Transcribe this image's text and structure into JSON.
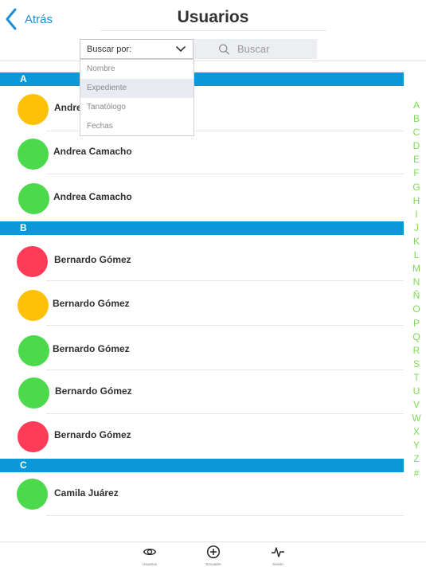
{
  "header": {
    "back_label": "Atrás",
    "title": "Usuarios"
  },
  "search": {
    "select_label": "Buscar por:",
    "placeholder": "Buscar"
  },
  "dropdown": {
    "options": [
      "Nombre",
      "Expediente",
      "Tanatólogo",
      "Fechas"
    ],
    "highlighted": "Expediente"
  },
  "sections": [
    {
      "letter": "A",
      "contacts": [
        {
          "name": "Andrea Camacho",
          "status_color": "#ffc107"
        },
        {
          "name": "Andrea Camacho",
          "status_color": "#4cd94c"
        },
        {
          "name": "Andrea Camacho",
          "status_color": "#4cd94c"
        }
      ]
    },
    {
      "letter": "B",
      "contacts": [
        {
          "name": "Bernardo Gómez",
          "status_color": "#ff3b57"
        },
        {
          "name": "Bernardo Gómez",
          "status_color": "#ffc107"
        },
        {
          "name": "Bernardo Gómez",
          "status_color": "#4cd94c"
        },
        {
          "name": "Bernardo Gómez",
          "status_color": "#4cd94c"
        },
        {
          "name": "Bernardo Gómez",
          "status_color": "#ff3b57"
        }
      ]
    },
    {
      "letter": "C",
      "contacts": [
        {
          "name": "Camila Juárez",
          "status_color": "#4cd94c"
        }
      ]
    }
  ],
  "alpha_index": [
    "A",
    "B",
    "C",
    "D",
    "E",
    "F",
    "G",
    "H",
    "I",
    "J",
    "K",
    "L",
    "M",
    "N",
    "Ñ",
    "O",
    "P",
    "Q",
    "R",
    "S",
    "T",
    "U",
    "V",
    "W",
    "X",
    "Y",
    "Z",
    "#"
  ],
  "tabbar": {
    "tabs": [
      {
        "label": "Usuarios",
        "icon": "eye-icon"
      },
      {
        "label": "Encuadre",
        "icon": "plus-circle-icon"
      },
      {
        "label": "Sesión",
        "icon": "pulse-icon"
      }
    ]
  },
  "colors": {
    "accent": "#1a8fd1",
    "section_bar": "#0a98d8",
    "index_letters": "#7ed957"
  }
}
